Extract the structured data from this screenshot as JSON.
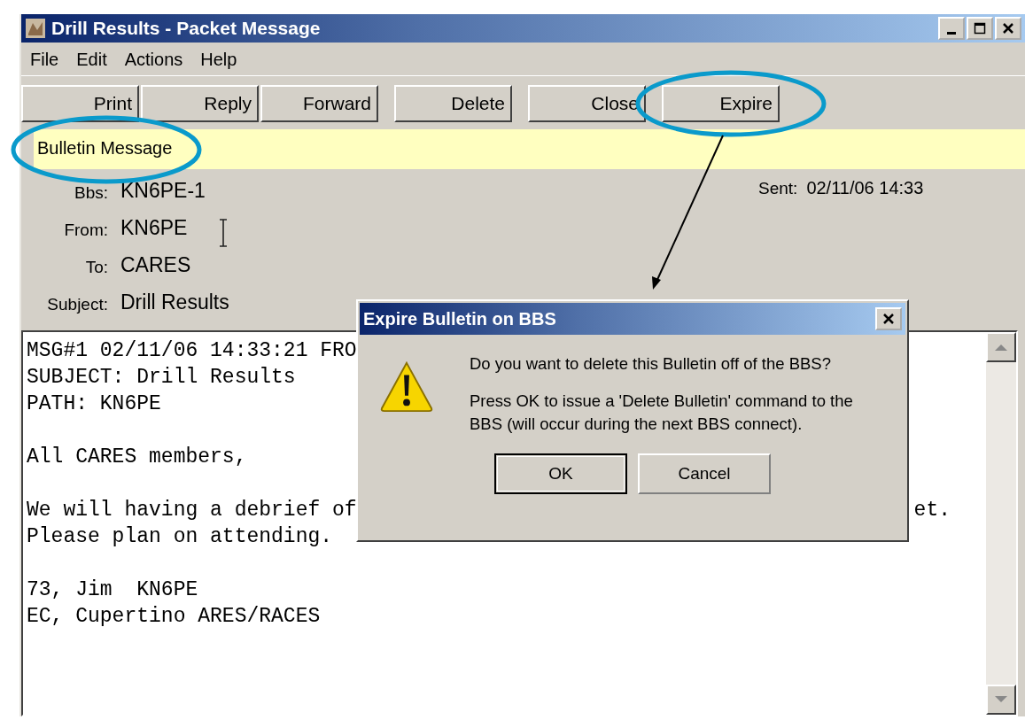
{
  "window": {
    "title": "Drill Results - Packet Message"
  },
  "menu": [
    "File",
    "Edit",
    "Actions",
    "Help"
  ],
  "toolbar_groups": [
    [
      "Print",
      "Reply",
      "Forward"
    ],
    [
      "Delete"
    ],
    [
      "Close"
    ],
    [
      "Expire"
    ]
  ],
  "banner": "Bulletin Message",
  "headers": [
    {
      "label": "Bbs:",
      "value": "KN6PE-1"
    },
    {
      "label": "From:",
      "value": "KN6PE"
    },
    {
      "label": "To:",
      "value": "CARES"
    },
    {
      "label": "Subject:",
      "value": "Drill Results"
    }
  ],
  "sent": {
    "label": "Sent:",
    "value": "02/11/06 14:33"
  },
  "body_paragraphs": [
    [
      {
        "text": "MSG#1 02/11/06 14:33:21 FRO"
      },
      {
        "text": "SUBJECT: Drill Results"
      },
      {
        "text": "PATH: KN6PE"
      }
    ],
    [
      {
        "text": "All CARES members,"
      }
    ],
    [
      {
        "text": "We will having a debrief of",
        "tail": "et."
      },
      {
        "text": "Please plan on attending."
      }
    ],
    [
      {
        "text": "73, Jim  KN6PE"
      },
      {
        "text": "EC, Cupertino ARES/RACES"
      }
    ]
  ],
  "dialog": {
    "title": "Expire Bulletin on BBS",
    "question": "Do you want to delete this Bulletin off of the BBS?",
    "detail": "Press OK to issue a 'Delete Bulletin' command to the BBS (will occur during the next BBS connect).",
    "buttons": [
      {
        "label": "OK",
        "default": true
      },
      {
        "label": "Cancel",
        "default": false
      }
    ]
  }
}
